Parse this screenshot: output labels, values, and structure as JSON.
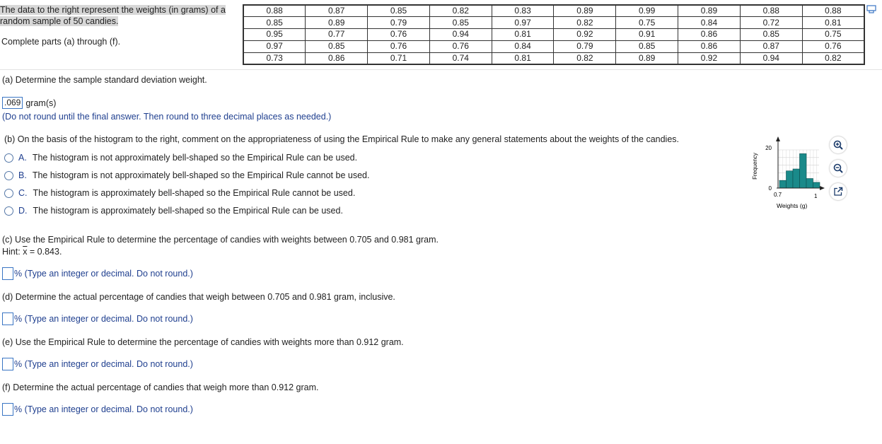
{
  "intro": {
    "line1": "The data to the right represent the weights (in grams) of a",
    "line2": "random sample of 50 candies.",
    "complete": "Complete parts (a) through (f)."
  },
  "data_table": [
    [
      "0.88",
      "0.87",
      "0.85",
      "0.82",
      "0.83",
      "0.89",
      "0.99",
      "0.89",
      "0.88",
      "0.88"
    ],
    [
      "0.85",
      "0.89",
      "0.79",
      "0.85",
      "0.97",
      "0.82",
      "0.75",
      "0.84",
      "0.72",
      "0.81"
    ],
    [
      "0.95",
      "0.77",
      "0.76",
      "0.94",
      "0.81",
      "0.92",
      "0.91",
      "0.86",
      "0.85",
      "0.75"
    ],
    [
      "0.97",
      "0.85",
      "0.76",
      "0.76",
      "0.84",
      "0.79",
      "0.85",
      "0.86",
      "0.87",
      "0.76"
    ],
    [
      "0.73",
      "0.86",
      "0.71",
      "0.74",
      "0.81",
      "0.82",
      "0.89",
      "0.92",
      "0.94",
      "0.82"
    ]
  ],
  "part_a": {
    "question": "(a) Determine the sample standard deviation weight.",
    "answer_value": ".069",
    "unit": "gram(s)",
    "note": "(Do not round until the final answer. Then round to three decimal places as needed.)"
  },
  "part_b": {
    "question": "(b) On the basis of the histogram to the right, comment on the appropriateness of using the Empirical Rule to make any general statements about the weights of the candies.",
    "options": [
      {
        "letter": "A.",
        "text": "The histogram is not approximately bell-shaped so the Empirical Rule can be used."
      },
      {
        "letter": "B.",
        "text": "The histogram is not approximately bell-shaped so the Empirical Rule cannot be used."
      },
      {
        "letter": "C.",
        "text": "The histogram is approximately bell-shaped so the Empirical Rule cannot be used."
      },
      {
        "letter": "D.",
        "text": "The histogram is approximately bell-shaped so the Empirical Rule can be used."
      }
    ]
  },
  "histogram": {
    "ylabel": "Frequency",
    "xlabel": "Weights (g)",
    "y_tick_top": "20",
    "y_tick_bottom": "0",
    "x_tick_left": "0.7",
    "x_tick_right": "1",
    "bar_color": "#1a8a8a",
    "chart_data": {
      "type": "bar",
      "categories": [
        "0.70",
        "0.75",
        "0.80",
        "0.85",
        "0.90",
        "0.95"
      ],
      "values": [
        4,
        9,
        10,
        18,
        5,
        3
      ],
      "ylim": [
        0,
        20
      ]
    }
  },
  "part_c": {
    "question": "(c) Use the Empirical Rule to determine the percentage of candies with weights between 0.705 and 0.981 gram.",
    "hint_prefix": "Hint: ",
    "hint_var": "x",
    "hint_value": " = 0.843.",
    "answer_suffix": "% (Type an integer or decimal. Do not round.)"
  },
  "part_d": {
    "question": "(d) Determine the actual percentage of candies that weigh between 0.705 and 0.981 gram, inclusive.",
    "answer_suffix": "% (Type an integer or decimal. Do not round.)"
  },
  "part_e": {
    "question": "(e) Use the Empirical Rule to determine the percentage of candies with weights more than 0.912 gram.",
    "answer_suffix": "% (Type an integer or decimal. Do not round.)"
  },
  "part_f": {
    "question": "(f) Determine the actual percentage of candies that weigh more than 0.912 gram.",
    "answer_suffix": "% (Type an integer or decimal. Do not round.)"
  },
  "tools": [
    "zoom-in-icon",
    "zoom-out-icon",
    "expand-icon"
  ]
}
